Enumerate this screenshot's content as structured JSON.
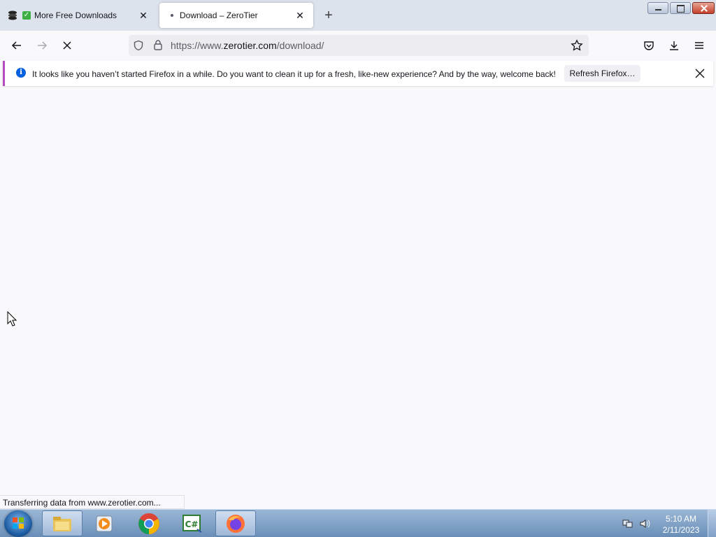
{
  "browser": {
    "tabs": [
      {
        "title": "More Free Downloads",
        "icon": "site-stack-icon",
        "badge": "green-check"
      },
      {
        "title": "Download – ZeroTier",
        "icon": "loading-dot",
        "active": true
      }
    ],
    "url": {
      "prefix": "https://www.",
      "host": "zerotier.com",
      "path": "/download/"
    },
    "notification": {
      "message": "It looks like you haven’t started Firefox in a while. Do you want to clean it up for a fresh, like-new experience? And by the way, welcome back!",
      "button_label": "Refresh Firefox…"
    },
    "status_text": "Transferring data from www.zerotier.com..."
  },
  "taskbar": {
    "items": [
      "windows-explorer",
      "media-player",
      "chrome",
      "csharp-editor",
      "firefox"
    ],
    "clock_time": "5:10 AM",
    "clock_date": "2/11/2023"
  },
  "colors": {
    "accent": "#0060df",
    "notification_border": "#b54bc0",
    "tab_strip": "#dde3ec"
  }
}
